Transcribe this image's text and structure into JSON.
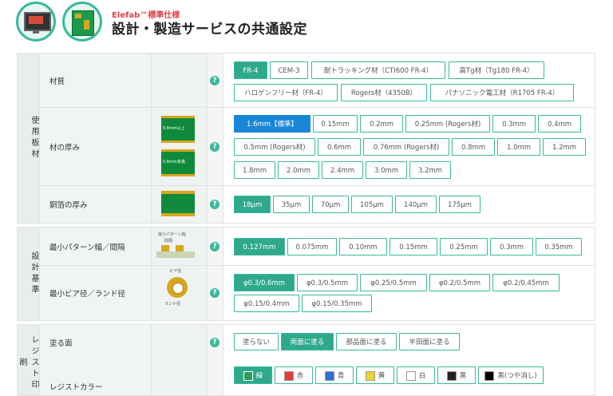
{
  "header": {
    "subtitle": "Elefab™標準仕様",
    "title": "設計・製造サービスの共通設定"
  },
  "sections": {
    "material": {
      "category": "使用板材"
    },
    "design": {
      "category": "設計基準"
    },
    "resist": {
      "category": "レジスト印刷"
    }
  },
  "rows": {
    "material": {
      "label": "材質",
      "options": [
        "FR-4",
        "CEM-3",
        "耐トラッキング材（CTI600 FR-4）",
        "高Tg材（Tg180 FR-4）",
        "ハロゲンフリー材（FR-4）",
        "Rogers材（4350B）",
        "パナソニック電工材（R1705 FR-4）"
      ]
    },
    "thickness": {
      "label": "材の厚み",
      "illus_top": "0.8mm以上",
      "illus_bottom": "0.8mm未満",
      "options": [
        "1.6mm【標準】",
        "0.15mm",
        "0.2mm",
        "0.25mm (Rogers材)",
        "0.3mm",
        "0.4mm",
        "0.5mm (Rogers材)",
        "0.6mm",
        "0.76mm (Rogers材)",
        "0.8mm",
        "1.0mm",
        "1.2mm",
        "1.8mm",
        "2.0mm",
        "2.4mm",
        "3.0mm",
        "3.2mm"
      ]
    },
    "copper": {
      "label": "銅箔の厚み",
      "options": [
        "18μm",
        "35μm",
        "70μm",
        "105μm",
        "140μm",
        "175μm"
      ]
    },
    "pattern": {
      "label": "最小パターン幅／間隔",
      "illus_title": "最小パターン幅",
      "illus_sub": "間隔",
      "options": [
        "0.127mm",
        "0.075mm",
        "0.10mm",
        "0.15mm",
        "0.25mm",
        "0.3mm",
        "0.35mm"
      ]
    },
    "via": {
      "label": "最小ビア径／ランド径",
      "illus_top": "ビア径",
      "illus_bottom": "ランド径",
      "options": [
        "φ0.3/0.6mm",
        "φ0.3/0.5mm",
        "φ0.25/0.5mm",
        "φ0.2/0.5mm",
        "φ0.2/0.45mm",
        "φ0.15/0.4mm",
        "φ0.15/0.35mm"
      ]
    },
    "coat": {
      "label": "塗る面",
      "options": [
        "塗らない",
        "両面に塗る",
        "部品面に塗る",
        "半田面に塗る"
      ]
    },
    "color": {
      "label": "レジストカラー",
      "options": [
        {
          "name": "緑",
          "color": "#2e9e56"
        },
        {
          "name": "赤",
          "color": "#e23b3b"
        },
        {
          "name": "青",
          "color": "#2f6fd6"
        },
        {
          "name": "黄",
          "color": "#f1d22e"
        },
        {
          "name": "白",
          "color": "#ffffff"
        },
        {
          "name": "黒",
          "color": "#222222"
        },
        {
          "name": "黒(つや消し)",
          "color": "#000000"
        }
      ]
    }
  },
  "colors": {
    "accent": "#2fa98d",
    "selected_blue": "#1a86d8"
  }
}
